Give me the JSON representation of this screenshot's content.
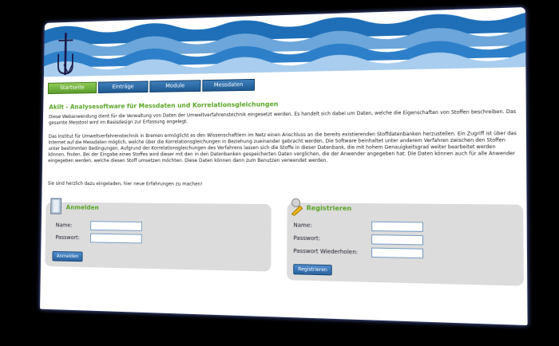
{
  "nav": [
    "Startseite",
    "Einträge",
    "Module",
    "Messdaten"
  ],
  "heading": "Akilt - Analysesoftware für Messdaten und Korrelationsgleichungen",
  "paragraphs": [
    "Diese Webanwendung dient für die Verwaltung von Daten der Umweltverfahrenstechnik eingesetzt werden. Es handelt sich dabei um Daten, welche die Eigenschaften von Stoffen beschreiben. Das gesamte Messtool wird im Basisdesign zur Erfassung angelegt.",
    "Das Institut für Umweltverfahrenstechnik in Bremen ermöglicht es den Wissenschaftlern im Netz einen Anschluss an die bereits existierenden Stoffdatenbanken herzustellen. Ein Zugriff ist über das Internet auf die Messdaten möglich, welche über die Korrelationsgleichungen in Beziehung zueinander gebracht werden. Die Software beinhaltet unter anderem Verfahren zwischen den Stoffen unter bestimmten Bedingungen. Aufgrund der Korrelationsgleichungen des Verfahrens lassen sich die Stoffe in dieser Datenbank, die mit hohem Genauigkeitsgrad weiter bearbeitet werden können, finden. Bei der Eingabe eines Stoffes wird dieser mit den in den Datenbanken gespeicherten Daten verglichen, die der Anwender angegeben hat. Die Daten können auch für alle Anwender eingegeben werden, welche diesen Stoff umsetzen möchten. Diese Daten können dann zum Benutzen verwendet werden.",
    "Sie sind herzlich dazu eingeladen, hier neue Erfahrungen zu machen!"
  ],
  "login": {
    "title": "Anmelden",
    "name_label": "Name:",
    "password_label": "Passwort:",
    "button": "Anmelden"
  },
  "register": {
    "title": "Registrieren",
    "name_label": "Name:",
    "password_label": "Passwort:",
    "repeat_label": "Passwort Wiederholen:",
    "button": "Registrieren"
  },
  "colors": {
    "accent_green": "#5aa526",
    "nav_blue": "#2a63a0"
  }
}
